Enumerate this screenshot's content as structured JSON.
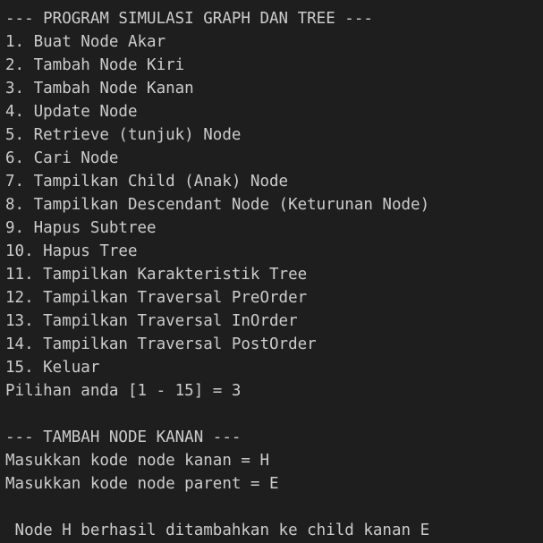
{
  "terminal": {
    "header": "--- PROGRAM SIMULASI GRAPH DAN TREE ---",
    "menu": [
      "1. Buat Node Akar",
      "2. Tambah Node Kiri",
      "3. Tambah Node Kanan",
      "4. Update Node",
      "5. Retrieve (tunjuk) Node",
      "6. Cari Node",
      "7. Tampilkan Child (Anak) Node",
      "8. Tampilkan Descendant Node (Keturunan Node)",
      "9. Hapus Subtree",
      "10. Hapus Tree",
      "11. Tampilkan Karakteristik Tree",
      "12. Tampilkan Traversal PreOrder",
      "13. Tampilkan Traversal InOrder",
      "14. Tampilkan Traversal PostOrder",
      "15. Keluar"
    ],
    "choice_prompt": "Pilihan anda [1 - 15] = 3",
    "section_header": "--- TAMBAH NODE KANAN ---",
    "input_node_prompt": "Masukkan kode node kanan = H",
    "input_parent_prompt": "Masukkan kode node parent = E",
    "result_message": " Node H berhasil ditambahkan ke child kanan E"
  }
}
